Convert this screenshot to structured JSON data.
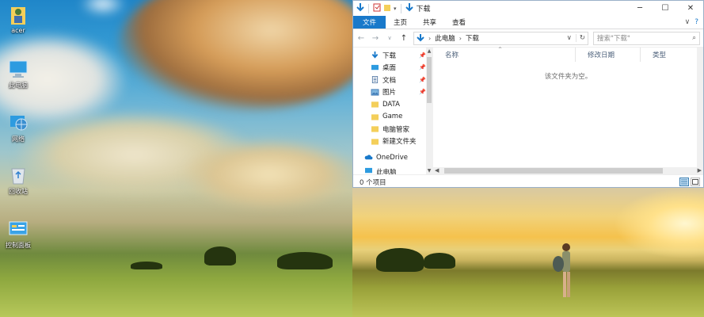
{
  "desktop": {
    "icons": [
      {
        "label": "acer"
      },
      {
        "label": "此电脑"
      },
      {
        "label": "网络"
      },
      {
        "label": "回收站"
      },
      {
        "label": "控制面板"
      }
    ]
  },
  "window": {
    "title": "下载",
    "ribbon": {
      "tabs": [
        "文件",
        "主页",
        "共享",
        "查看"
      ]
    },
    "address": {
      "path": [
        "此电脑",
        "下载"
      ]
    },
    "search": {
      "placeholder": "搜索\"下载\""
    },
    "nav": {
      "items": [
        {
          "label": "下载",
          "pinned": true
        },
        {
          "label": "桌面",
          "pinned": true
        },
        {
          "label": "文档",
          "pinned": true
        },
        {
          "label": "图片",
          "pinned": true
        },
        {
          "label": "DATA",
          "pinned": false
        },
        {
          "label": "Game",
          "pinned": false
        },
        {
          "label": "电脑管家",
          "pinned": false
        },
        {
          "label": "新建文件夹",
          "pinned": false
        },
        {
          "label": "OneDrive",
          "pinned": false
        },
        {
          "label": "此电脑",
          "pinned": false
        }
      ]
    },
    "columns": [
      "名称",
      "修改日期",
      "类型"
    ],
    "empty_message": "该文件夹为空。",
    "status": "0 个项目"
  },
  "colors": {
    "accent": "#1979ca",
    "folder": "#f4cf5a"
  }
}
